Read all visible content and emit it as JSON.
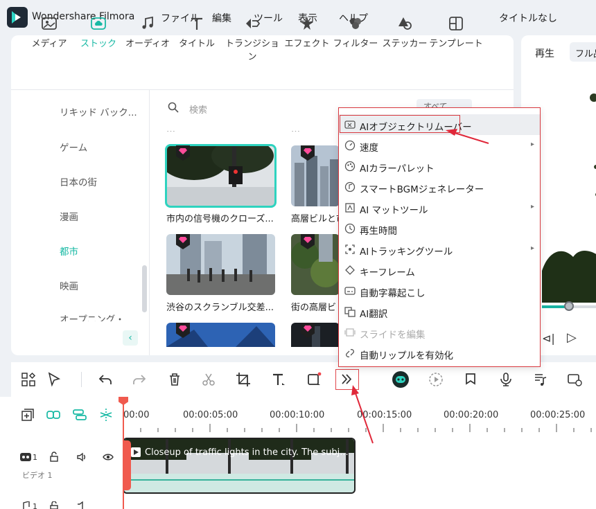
{
  "app": {
    "title": "Wondershare Filmora",
    "document_title": "タイトルなし"
  },
  "menu": [
    "ファイル",
    "編集",
    "ツール",
    "表示",
    "ヘルプ"
  ],
  "categories": [
    {
      "label": "メディア",
      "icon": "media-icon"
    },
    {
      "label": "ストック",
      "icon": "stock-cloud-icon",
      "active": true
    },
    {
      "label": "オーディオ",
      "icon": "audio-icon"
    },
    {
      "label": "タイトル",
      "icon": "title-icon"
    },
    {
      "label": "トランジション",
      "icon": "transition-icon"
    },
    {
      "label": "エフェクト",
      "icon": "effect-icon"
    },
    {
      "label": "フィルター",
      "icon": "filter-icon"
    },
    {
      "label": "ステッカー",
      "icon": "sticker-icon"
    },
    {
      "label": "テンプレート",
      "icon": "template-icon"
    }
  ],
  "sidebar": [
    {
      "label": "リキッド バック..."
    },
    {
      "label": "ゲーム"
    },
    {
      "label": "日本の街"
    },
    {
      "label": "漫画"
    },
    {
      "label": "都市",
      "active": true
    },
    {
      "label": "映画"
    },
    {
      "label": "オープニング・"
    }
  ],
  "search": {
    "placeholder": "検索",
    "sort_label": "すべて"
  },
  "media": {
    "row0_cut": [
      "…",
      "…"
    ],
    "items": [
      {
        "label": "市内の信号機のクローズ..."
      },
      {
        "label": "高層ビルと市"
      },
      {
        "label": "渋谷のスクランブル交差..."
      },
      {
        "label": "街の高層ビ"
      }
    ]
  },
  "preview": {
    "tab_play": "再生",
    "tab_full": "フル品"
  },
  "context_menu": [
    {
      "label": "AIオブジェクトリムーバー",
      "icon": "ai-object-remover-icon",
      "highlight": true
    },
    {
      "label": "速度",
      "icon": "speed-icon",
      "submenu": true
    },
    {
      "label": "AIカラーパレット",
      "icon": "color-palette-icon"
    },
    {
      "label": "スマートBGMジェネレーター",
      "icon": "bgm-generator-icon"
    },
    {
      "label": "AI マットツール",
      "icon": "matte-tool-icon",
      "submenu": true
    },
    {
      "label": "再生時間",
      "icon": "duration-icon"
    },
    {
      "label": "AIトラッキングツール",
      "icon": "tracking-icon",
      "submenu": true
    },
    {
      "label": "キーフレーム",
      "icon": "keyframe-icon"
    },
    {
      "label": "自動字幕起こし",
      "icon": "auto-subtitle-icon"
    },
    {
      "label": "AI翻訳",
      "icon": "ai-translate-icon"
    },
    {
      "label": "スライドを編集",
      "icon": "slide-edit-icon",
      "disabled": true
    },
    {
      "label": "自動リップルを有効化",
      "icon": "auto-ripple-icon"
    }
  ],
  "timeline": {
    "ruler": [
      "00:00",
      "00:00:05:00",
      "00:00:10:00",
      "00:00:15:00",
      "00:00:20:00",
      "00:00:25:00"
    ],
    "video_track_label": "ビデオ 1",
    "track_number": "1",
    "clip_title": "Closeup of traffic lights in the city. The subj..."
  },
  "colors": {
    "accent": "#18b9a4",
    "highlight_border": "#d8383e"
  }
}
